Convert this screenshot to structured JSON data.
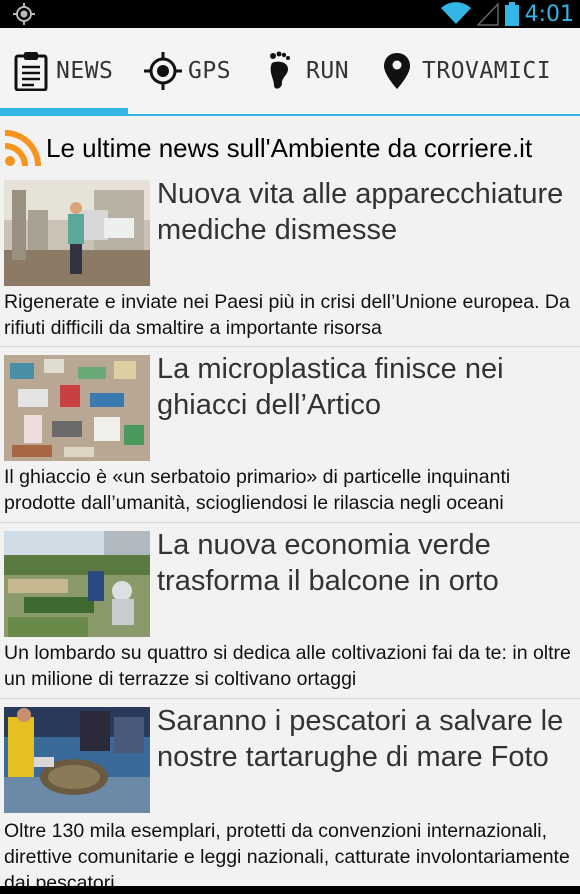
{
  "status_bar": {
    "time": "4:01",
    "icons": [
      "gps-icon",
      "wifi-icon",
      "signal-icon",
      "battery-icon"
    ]
  },
  "tabs": [
    {
      "label": "NEWS",
      "icon": "clipboard-icon",
      "selected": true
    },
    {
      "label": "GPS",
      "icon": "crosshair-icon",
      "selected": false
    },
    {
      "label": "RUN",
      "icon": "footprint-icon",
      "selected": false
    },
    {
      "label": "TROVAMICI",
      "icon": "location-pin-icon",
      "selected": false
    }
  ],
  "feed": {
    "icon": "rss-icon",
    "title": "Le ultime news sull'Ambiente da corriere.it"
  },
  "articles": [
    {
      "title": "Nuova vita alle apparecchiature mediche dismesse",
      "description": "Rigenerate e inviate nei Paesi più in crisi dell’Unione europea. Da rifiuti difficili da smaltire a importante risorsa"
    },
    {
      "title": "La microplastica finisce nei ghiacci dell’Artico",
      "description": "Il ghiaccio è «un serbatoio primario» di particelle inquinanti prodotte dall’umanità, sciogliendosi le rilascia negli oceani"
    },
    {
      "title": "La nuova economia verde trasforma il balcone in orto",
      "description": "Un lombardo su quattro si dedica alle coltivazioni fai da te: in oltre un milione di terrazze si coltivano ortaggi"
    },
    {
      "title": "Saranno i pescatori a salvare le nostre tartarughe di mare Foto",
      "description": "Oltre 130 mila esemplari, protetti da convenzioni internazionali, direttive comunitarie e leggi nazionali, catturate involontariamente dai pescatori"
    }
  ],
  "colors": {
    "accent": "#33b5e5",
    "rss": "#f7941d"
  }
}
